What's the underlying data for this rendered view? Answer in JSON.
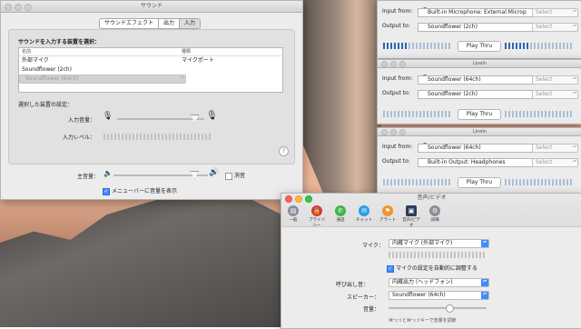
{
  "sound_window": {
    "title": "サウンド",
    "tabs": [
      "サウンドエフェクト",
      "出力",
      "入力"
    ],
    "active_tab": 2,
    "device_prompt": "サウンドを入力する装置を選択：",
    "columns": [
      "名前",
      "種類"
    ],
    "devices": [
      {
        "name": "外部マイク",
        "type": "マイクポート"
      },
      {
        "name": "Soundflower (2ch)",
        "type": ""
      },
      {
        "name": "Soundflower (64ch)",
        "type": ""
      }
    ],
    "selected_device_index": 2,
    "settings_label": "選択した装置の設定：",
    "input_volume_label": "入力音量：",
    "input_volume_level": 0.88,
    "input_level_label": "入力レベル：",
    "help": "?",
    "main_volume_label": "主音量：",
    "main_volume_level": 0.85,
    "mute_label": "消音",
    "mute_checked": false,
    "menubar_label": "メニューバーに音量を表示",
    "menubar_checked": true
  },
  "linein_windows": [
    {
      "title": "",
      "input_label": "Input from:",
      "input_value": "Built-in Microphone: External Microp",
      "input_select": "Select",
      "output_label": "Output to:",
      "output_value": "Soundflower (2ch)",
      "output_select": "Select",
      "button": "Play Thru",
      "level_left": 0.35,
      "level_right": 0.35
    },
    {
      "title": "LineIn",
      "input_label": "Input from:",
      "input_value": "Soundflower (64ch)",
      "input_select": "Select",
      "output_label": "Output to:",
      "output_value": "Soundflower (2ch)",
      "output_select": "Select",
      "button": "Play Thru",
      "level_left": 0,
      "level_right": 0
    },
    {
      "title": "LineIn",
      "input_label": "Input from:",
      "input_value": "Soundflower (64ch)",
      "input_select": "Select",
      "output_label": "Output to:",
      "output_value": "Built-in Output: Headphones",
      "output_select": "Select",
      "button": "Play Thru",
      "level_left": 0,
      "level_right": 0
    }
  ],
  "av_window": {
    "title": "音声/ビデオ",
    "toolbar": [
      {
        "label": "一般",
        "icon": "general-icon",
        "color": "#8a8f99"
      },
      {
        "label": "プライバシー",
        "icon": "lock-icon",
        "color": "#d9363e"
      },
      {
        "label": "通話",
        "icon": "phone-icon",
        "color": "#3cb44a"
      },
      {
        "label": "チャット",
        "icon": "chat-icon",
        "color": "#2f9be6"
      },
      {
        "label": "アラート",
        "icon": "alert-icon",
        "color": "#f0942c"
      },
      {
        "label": "音声/ビデオ",
        "icon": "audio-video-icon",
        "color": "#2a3d5a"
      },
      {
        "label": "詳細",
        "icon": "gear-icon",
        "color": "#8a8f99"
      }
    ],
    "active_tool": 5,
    "mic_label": "マイク：",
    "mic_value": "内蔵マイク (外部マイク)",
    "auto_adjust_label": "マイクの設定を自動的に調整する",
    "auto_adjust_checked": true,
    "ringer_label": "呼び出し音：",
    "ringer_value": "内蔵出力 (ヘッドフォン)",
    "speaker_label": "スピーカー：",
    "speaker_value": "Soundflower (64ch)",
    "volume_label": "音量：",
    "volume_level": 0.62,
    "shortcut_hint": "⌘⌥⇧と⌘⌥⇧キーで音量を調節"
  }
}
